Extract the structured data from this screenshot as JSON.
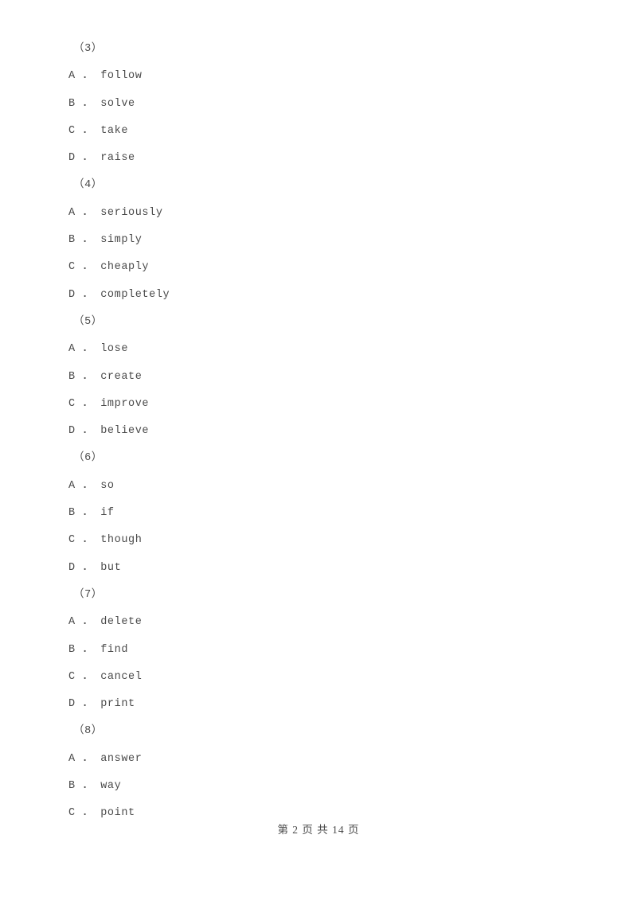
{
  "document": {
    "background_color": "#ffffff",
    "text_color": "#4a4a4a"
  },
  "questions": [
    {
      "number": "（3）",
      "options": [
        {
          "letter": "A",
          "separator": " ．",
          "text": "follow"
        },
        {
          "letter": "B",
          "separator": " ．",
          "text": "solve"
        },
        {
          "letter": "C",
          "separator": " ．",
          "text": "take"
        },
        {
          "letter": "D",
          "separator": " ．",
          "text": "raise"
        }
      ]
    },
    {
      "number": "（4）",
      "options": [
        {
          "letter": "A",
          "separator": " ．",
          "text": "seriously"
        },
        {
          "letter": "B",
          "separator": " ．",
          "text": "simply"
        },
        {
          "letter": "C",
          "separator": " ．",
          "text": "cheaply"
        },
        {
          "letter": "D",
          "separator": " ．",
          "text": "completely"
        }
      ]
    },
    {
      "number": "（5）",
      "options": [
        {
          "letter": "A",
          "separator": " ．",
          "text": "lose"
        },
        {
          "letter": "B",
          "separator": " ．",
          "text": "create"
        },
        {
          "letter": "C",
          "separator": " ．",
          "text": "improve"
        },
        {
          "letter": "D",
          "separator": " ．",
          "text": "believe"
        }
      ]
    },
    {
      "number": "（6）",
      "options": [
        {
          "letter": "A",
          "separator": " ．",
          "text": "so"
        },
        {
          "letter": "B",
          "separator": " ．",
          "text": "if"
        },
        {
          "letter": "C",
          "separator": " ．",
          "text": "though"
        },
        {
          "letter": "D",
          "separator": " ．",
          "text": "but"
        }
      ]
    },
    {
      "number": "（7）",
      "options": [
        {
          "letter": "A",
          "separator": " ．",
          "text": "delete"
        },
        {
          "letter": "B",
          "separator": " ．",
          "text": "find"
        },
        {
          "letter": "C",
          "separator": " ．",
          "text": "cancel"
        },
        {
          "letter": "D",
          "separator": " ．",
          "text": "print"
        }
      ]
    },
    {
      "number": "（8）",
      "options": [
        {
          "letter": "A",
          "separator": " ．",
          "text": "answer"
        },
        {
          "letter": "B",
          "separator": " ．",
          "text": "way"
        },
        {
          "letter": "C",
          "separator": " ．",
          "text": "point"
        }
      ]
    }
  ],
  "footer": {
    "text": "第 2 页 共 14 页",
    "current_page": "2",
    "total_pages": "14"
  }
}
